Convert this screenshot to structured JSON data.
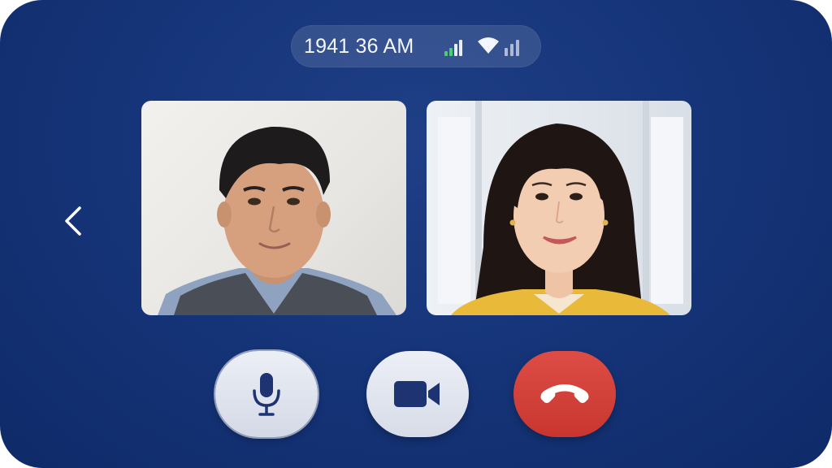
{
  "status_bar": {
    "time": "1941 36 AM",
    "icons": [
      "cellular-signal-icon",
      "wifi-icon",
      "secondary-signal-icon"
    ]
  },
  "navigation": {
    "back_icon": "chevron-left-icon"
  },
  "participants": [
    {
      "role": "participant-1",
      "icon": "video-feed"
    },
    {
      "role": "participant-2",
      "icon": "video-feed"
    }
  ],
  "controls": [
    {
      "id": "mute",
      "icon": "microphone-icon"
    },
    {
      "id": "video",
      "icon": "video-camera-icon"
    },
    {
      "id": "end",
      "icon": "phone-hangup-icon",
      "color": "#d2403a"
    }
  ],
  "colors": {
    "background": "#16357a",
    "signal_active": "#4ad06b",
    "end_call": "#d2403a",
    "control_icon": "#1e3372"
  }
}
